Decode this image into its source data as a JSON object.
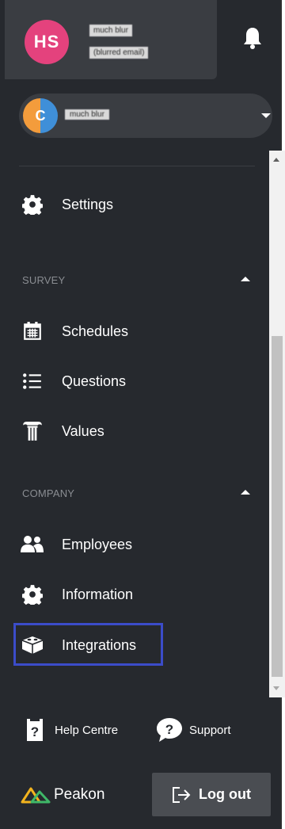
{
  "header": {
    "avatar_initials": "HS",
    "avatar_color": "#e4427d",
    "user_name": "much blur",
    "user_email": "(blurred email)",
    "notifications_icon": "bell-icon"
  },
  "company": {
    "logo_letter": "C",
    "name": "much blur"
  },
  "menu": {
    "settings": {
      "label": "Settings",
      "icon": "gear-icon"
    },
    "survey": {
      "label": "SURVEY",
      "items": [
        {
          "label": "Schedules",
          "icon": "calendar-icon"
        },
        {
          "label": "Questions",
          "icon": "list-icon"
        },
        {
          "label": "Values",
          "icon": "pillar-icon"
        }
      ]
    },
    "company": {
      "label": "COMPANY",
      "items": [
        {
          "label": "Employees",
          "icon": "people-icon"
        },
        {
          "label": "Information",
          "icon": "gear-icon"
        },
        {
          "label": "Integrations",
          "icon": "puzzle-icon"
        }
      ]
    }
  },
  "footer": {
    "help_label": "Help Centre",
    "support_label": "Support",
    "brand": "Peakon",
    "logout_label": "Log out"
  },
  "colors": {
    "sidebar_bg": "#26292e",
    "card_bg": "#3a3d42",
    "highlight": "#3b4cc9"
  }
}
